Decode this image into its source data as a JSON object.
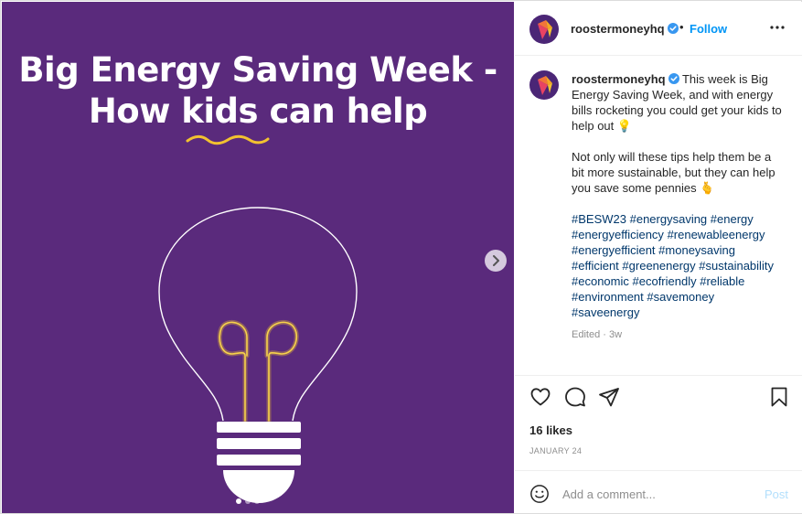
{
  "media": {
    "title_line1": "Big Energy Saving Week -",
    "title_line2_prefix": "How ",
    "title_line2_highlight": "kids",
    "title_line2_suffix": " can help",
    "background_color": "#5a2a7c",
    "accent_color": "#f2c230",
    "carousel_count": 3,
    "carousel_active_index": 0
  },
  "header": {
    "username": "roostermoneyhq",
    "separator": "•",
    "follow_label": "Follow"
  },
  "caption": {
    "username": "roostermoneyhq",
    "paragraph1": "This week is Big Energy Saving Week, and with energy bills rocketing you could get your kids to help out 💡",
    "paragraph2": "Not only will these tips help them be a bit more sustainable, but they can help you save some pennies 🫰",
    "hashtags": [
      "#BESW23",
      "#energysaving",
      "#energy",
      "#energyefficiency",
      "#renewableenergy",
      "#energyefficient",
      "#moneysaving",
      "#efficient",
      "#greenenergy",
      "#sustainability",
      "#economic",
      "#ecofriendly",
      "#reliable",
      "#environment",
      "#savemoney",
      "#saveenergy"
    ],
    "edited": "Edited · 3w"
  },
  "actions": {
    "icons": [
      "heart-icon",
      "comment-icon",
      "share-icon",
      "bookmark-icon"
    ]
  },
  "likes": "16 likes",
  "date": "JANUARY 24",
  "comment": {
    "placeholder": "Add a comment...",
    "post_label": "Post"
  },
  "colors": {
    "link_blue": "#0095f6",
    "hashtag_blue": "#00376b",
    "muted": "#8e8e8e"
  }
}
